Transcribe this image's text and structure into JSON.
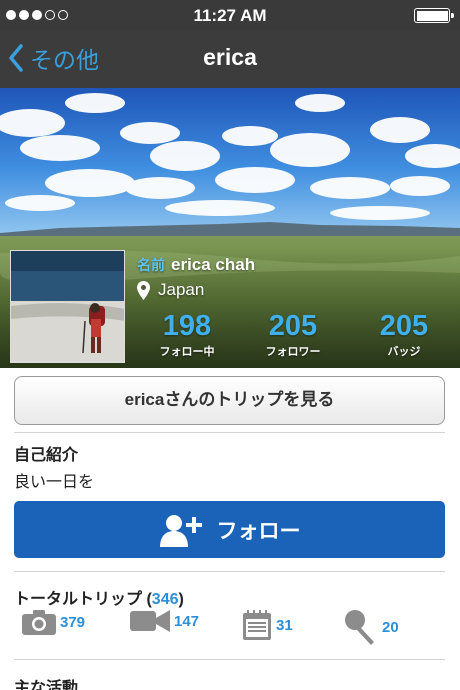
{
  "status_bar": {
    "time": "11:27 AM",
    "signal_dots_filled": 3,
    "signal_dots_total": 5,
    "battery_level": 1.0
  },
  "nav": {
    "back_label": "その他",
    "title": "erica"
  },
  "profile": {
    "name_label": "名前",
    "name": "erica chah",
    "location": "Japan",
    "stats": [
      {
        "value": "198",
        "label": "フォロー中"
      },
      {
        "value": "205",
        "label": "フォロワー"
      },
      {
        "value": "205",
        "label": "バッジ"
      }
    ]
  },
  "trips_button": "ericaさんのトリップを見る",
  "intro": {
    "title": "自己紹介",
    "text": "良い一日を"
  },
  "follow_button": "フォロー",
  "total_trips": {
    "label": "トータルトリップ",
    "open_paren": "(",
    "count": "346",
    "close_paren": ")",
    "items": [
      {
        "icon": "camera-icon",
        "value": "379"
      },
      {
        "icon": "video-icon",
        "value": "147"
      },
      {
        "icon": "notepad-icon",
        "value": "31"
      },
      {
        "icon": "microphone-icon",
        "value": "20"
      }
    ]
  },
  "main_activity": {
    "title": "主な活動"
  },
  "colors": {
    "accent": "#2d8fd5",
    "follow_button": "#1b63b8",
    "navbar": "#3c3c3c",
    "back_link": "#3b9fdc"
  }
}
